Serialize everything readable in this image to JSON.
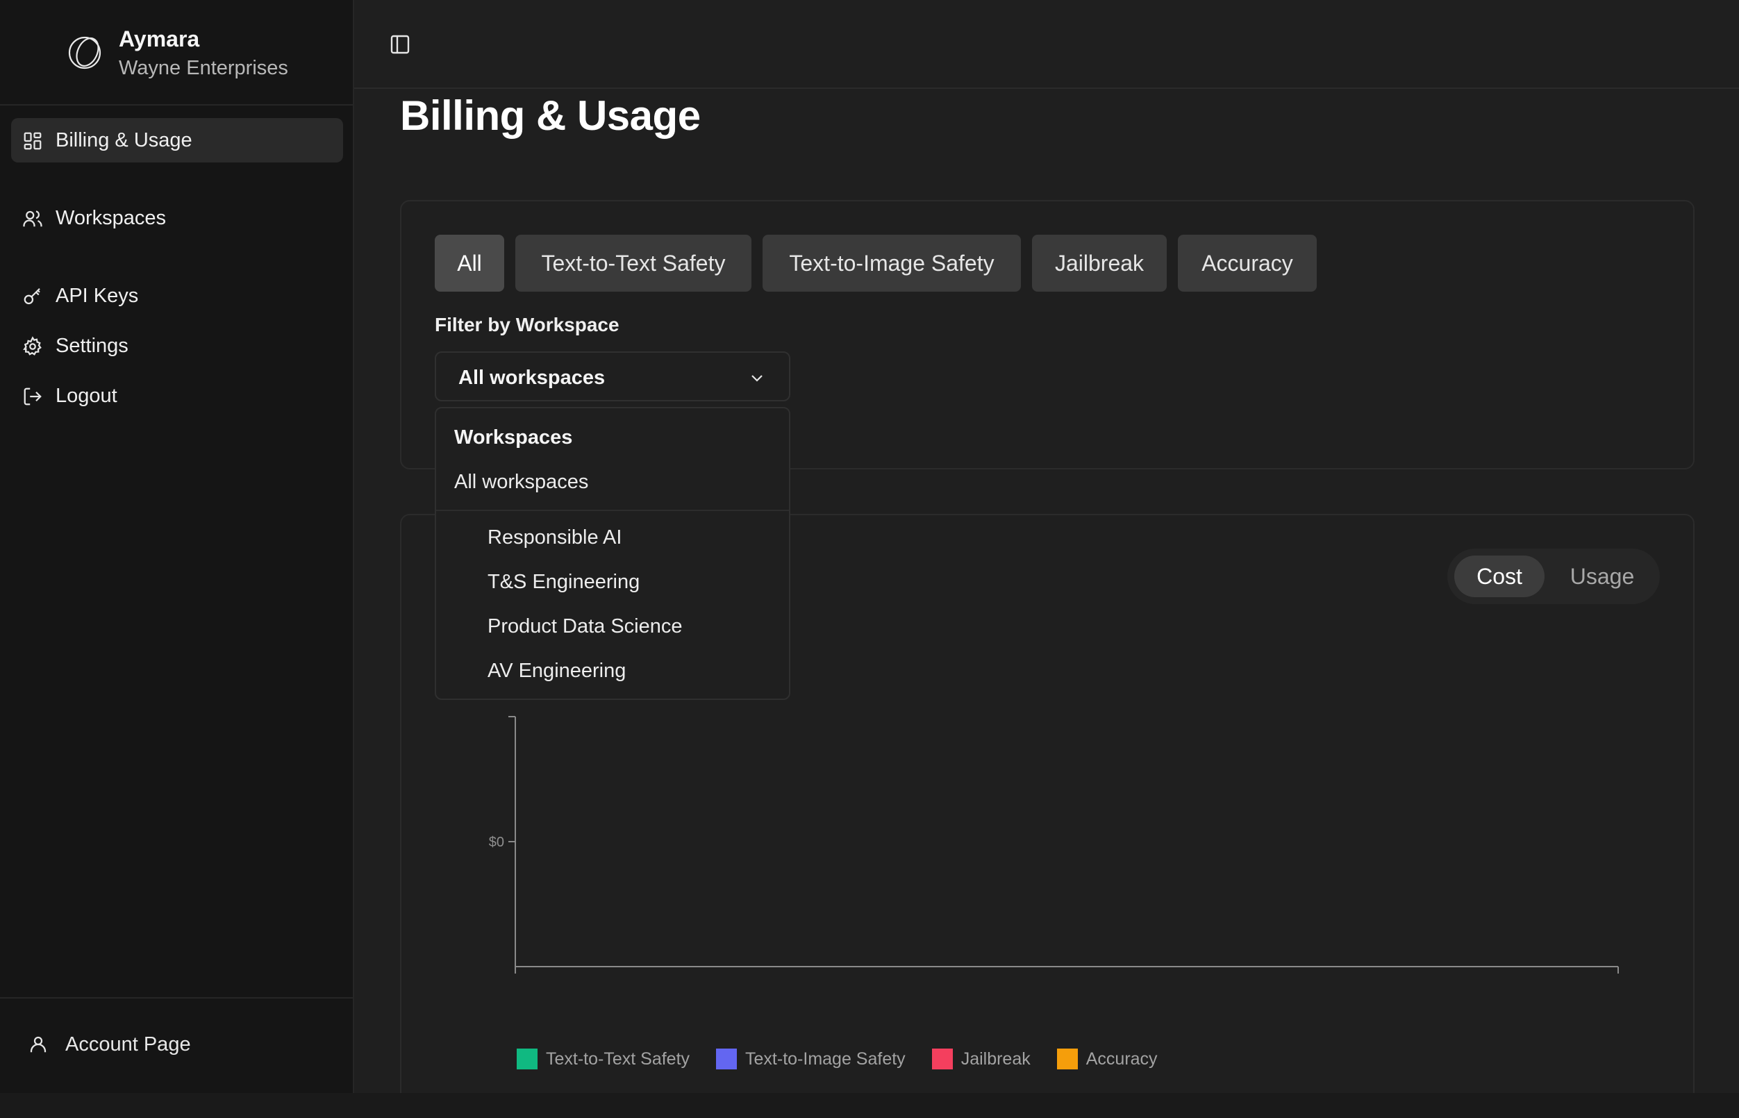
{
  "brand": {
    "name": "Aymara",
    "org": "Wayne Enterprises"
  },
  "sidebar": {
    "items": [
      {
        "label": "Billing & Usage",
        "icon": "dashboard-icon",
        "active": true
      },
      {
        "label": "Workspaces",
        "icon": "users-icon"
      },
      {
        "label": "API Keys",
        "icon": "key-icon"
      },
      {
        "label": "Settings",
        "icon": "gear-icon"
      },
      {
        "label": "Logout",
        "icon": "logout-icon"
      }
    ],
    "footer": {
      "label": "Account Page",
      "icon": "user-icon"
    }
  },
  "page": {
    "title": "Billing & Usage"
  },
  "filters": {
    "tabs": [
      {
        "label": "All",
        "active": true
      },
      {
        "label": "Text-to-Text Safety"
      },
      {
        "label": "Text-to-Image Safety"
      },
      {
        "label": "Jailbreak"
      },
      {
        "label": "Accuracy"
      }
    ],
    "workspace_label": "Filter by Workspace",
    "workspace_selected": "All workspaces"
  },
  "dropdown": {
    "heading": "Workspaces",
    "all_option": "All workspaces",
    "options": [
      "Responsible AI",
      "T&S Engineering",
      "Product Data Science",
      "AV Engineering"
    ]
  },
  "toggle": {
    "options": [
      "Cost",
      "Usage"
    ],
    "active": "Cost"
  },
  "chart_data": {
    "type": "bar",
    "categories": [],
    "series": [
      {
        "name": "Text-to-Text Safety",
        "values": [],
        "color": "#10b981"
      },
      {
        "name": "Text-to-Image Safety",
        "values": [],
        "color": "#6366f1"
      },
      {
        "name": "Jailbreak",
        "values": [],
        "color": "#f43f5e"
      },
      {
        "name": "Accuracy",
        "values": [],
        "color": "#f59e0b"
      }
    ],
    "y_ticks": [
      "$0"
    ],
    "grid": false,
    "legend_position": "bottom"
  },
  "colors": {
    "background": "#1f1f1f",
    "sidebar": "#151515",
    "accent_active": "#3c3c3c"
  }
}
